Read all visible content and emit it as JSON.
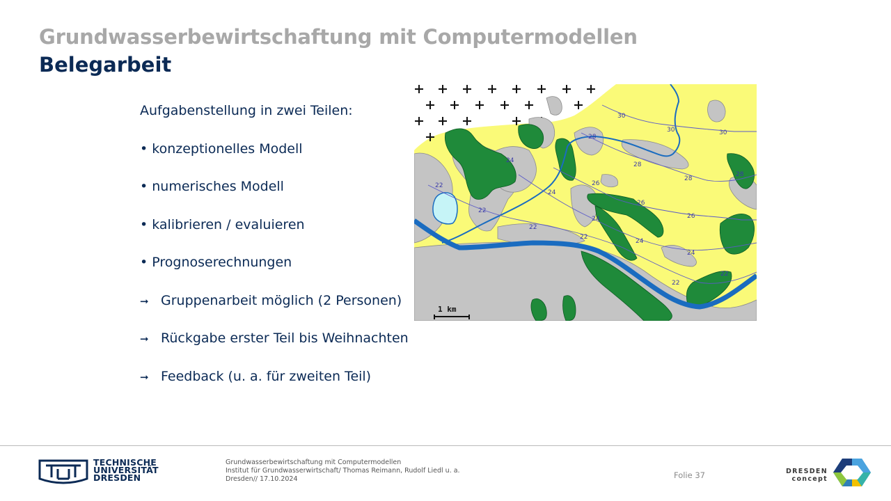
{
  "header": {
    "title": "Grundwasserbewirtschaftung mit Computermodellen",
    "subtitle": "Belegarbeit"
  },
  "content": {
    "intro": "Aufgabenstellung in zwei Teilen:",
    "bullets": [
      "• konzeptionelles Modell",
      "• numerisches Modell",
      "• kalibrieren / evaluieren",
      "• Prognoserechnungen"
    ],
    "arrow_items": [
      "Gruppenarbeit möglich (2 Personen)",
      "Rückgabe erster Teil bis Weihnachten",
      "Feedback (u. a. für zweiten Teil)"
    ]
  },
  "map": {
    "scale_label": "1 km",
    "contour_labels": [
      "30",
      "30",
      "30",
      "28",
      "28",
      "28",
      "28",
      "26",
      "26",
      "26",
      "24",
      "24",
      "24",
      "24",
      "24",
      "22",
      "22",
      "22",
      "22",
      "22",
      "22"
    ]
  },
  "footer": {
    "tud_logo_lines": [
      "TECHNISCHE",
      "UNIVERSITÄT",
      "DRESDEN"
    ],
    "info_lines": [
      "Grundwasserbewirtschaftung mit Computermodellen",
      "Institut für Grundwasserwirtschaft/ Thomas Reimann, Rudolf Liedl u. a.",
      "Dresden// 17.10.2024"
    ],
    "slide_number": "Folie 37",
    "dc_lines": [
      "DRESDEN",
      "concept"
    ]
  },
  "colors": {
    "title_gray": "#a8a8a8",
    "navy": "#0b2a55",
    "map_yellow": "#fafa78",
    "map_gray": "#c4c4c4",
    "map_green": "#1f8a3a",
    "map_river": "#1a6cc0"
  }
}
